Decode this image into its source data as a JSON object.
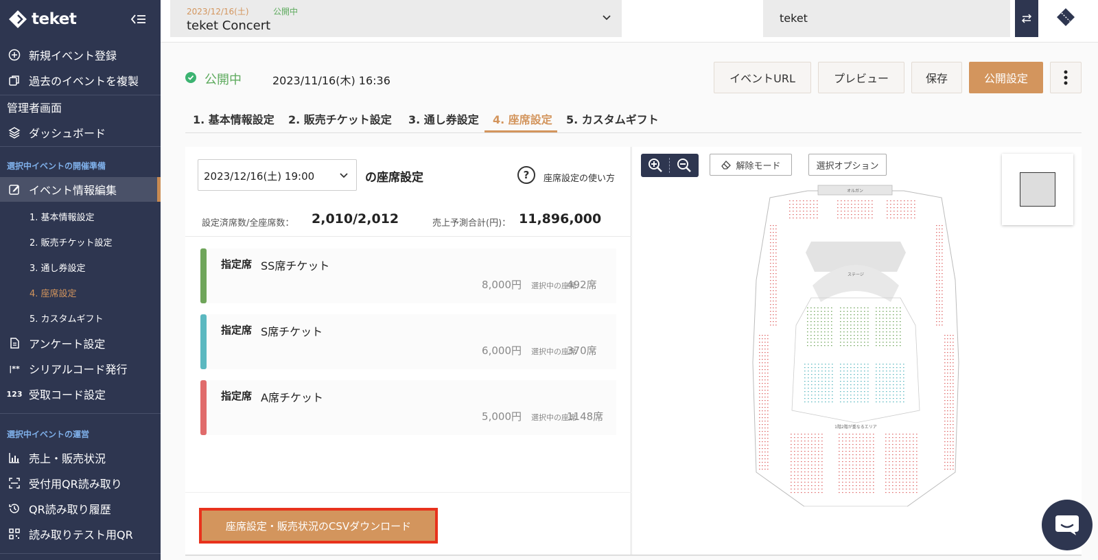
{
  "sidebar": {
    "logo_text": "teket",
    "items_top": [
      {
        "label": "新規イベント登録",
        "icon": "plus-circle-icon"
      },
      {
        "label": "過去のイベントを複製",
        "icon": "copy-icon"
      }
    ],
    "admin_label": "管理者画面",
    "dashboard_label": "ダッシュボード",
    "section_prep": "選択中イベントの開催準備",
    "edit_label": "イベント情報編集",
    "sub_items": [
      "1. 基本情報設定",
      "2. 販売チケット設定",
      "3. 通し券設定",
      "4. 座席設定",
      "5. カスタムギフト"
    ],
    "items_prep": [
      {
        "label": "アンケート設定",
        "icon": "document-icon"
      },
      {
        "label": "シリアルコード発行",
        "icon": "serial-code-icon"
      },
      {
        "label": "受取コード設定",
        "icon": "number-123-icon"
      }
    ],
    "section_ops": "選択中イベントの運営",
    "items_ops": [
      {
        "label": "売上・販売状況",
        "icon": "bar-chart-icon"
      },
      {
        "label": "受付用QR読み取り",
        "icon": "qr-scan-icon"
      },
      {
        "label": "QR読み取り履歴",
        "icon": "history-icon"
      },
      {
        "label": "読み取りテスト用QR",
        "icon": "qr-code-icon"
      }
    ]
  },
  "header": {
    "event_date": "2023/12/16(土)",
    "event_status": "公開中",
    "event_name": "teket Concert",
    "org_name": "teket"
  },
  "status": {
    "label": "公開中",
    "datetime": "2023/11/16(木) 16:36"
  },
  "actions": {
    "event_url": "イベントURL",
    "preview": "プレビュー",
    "save": "保存",
    "publish": "公開設定"
  },
  "tabs": [
    "1. 基本情報設定",
    "2. 販売チケット設定",
    "3. 通し券設定",
    "4. 座席設定",
    "5. カスタムギフト"
  ],
  "seat_panel": {
    "date_value": "2023/12/16(土) 19:00",
    "title": "の座席設定",
    "help": "座席設定の使い方",
    "count_label": "設定済席数/全座席数：",
    "count_value": "2,010/2,012",
    "sales_label": "売上予測合計(円)：",
    "sales_value": "11,896,000",
    "tickets": [
      {
        "kind": "指定席",
        "name": "SS席チケット",
        "price": "8,000円",
        "sel_label": "選択中の座席",
        "seats": "492席",
        "color": "#6fa55a"
      },
      {
        "kind": "指定席",
        "name": "S席チケット",
        "price": "6,000円",
        "sel_label": "選択中の座席",
        "seats": "370席",
        "color": "#5bb8c0"
      },
      {
        "kind": "指定席",
        "name": "A席チケット",
        "price": "5,000円",
        "sel_label": "選択中の座席",
        "seats": "1148席",
        "color": "#e06b6b"
      }
    ],
    "csv_button": "座席設定・販売状況のCSVダウンロード"
  },
  "map": {
    "erase_mode": "解除モード",
    "select_options": "選択オプション",
    "organ": "オルガン",
    "stage": "ステージ",
    "area_note": "1階2階が重なるエリア"
  },
  "colors": {
    "sidebar_bg": "#2e3650",
    "accent": "#d3955d",
    "status_green": "#5daa5d",
    "ss_green": "#6fa55a",
    "s_teal": "#5bb8c0",
    "a_red": "#e06b6b"
  }
}
